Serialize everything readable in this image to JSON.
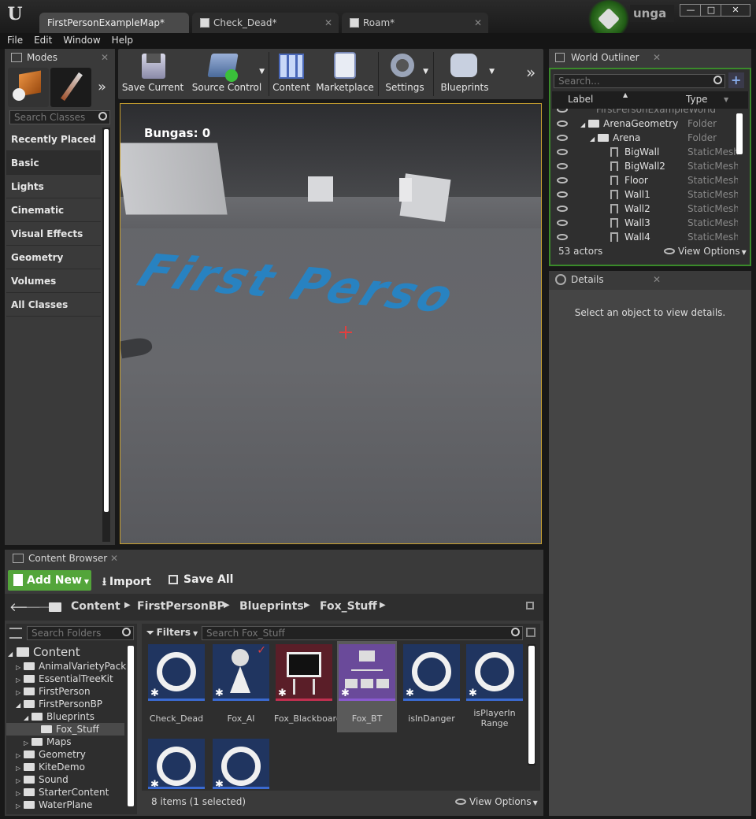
{
  "window": {
    "tabs": [
      {
        "label": "FirstPersonExampleMap*"
      },
      {
        "label": "Check_Dead*"
      },
      {
        "label": "Roam*"
      }
    ],
    "user": "unga",
    "controls": [
      "—",
      "□",
      "✕"
    ]
  },
  "menu": [
    "File",
    "Edit",
    "Window",
    "Help"
  ],
  "modes": {
    "title": "Modes",
    "search_placeholder": "Search Classes",
    "categories": [
      "Recently Placed",
      "Basic",
      "Lights",
      "Cinematic",
      "Visual Effects",
      "Geometry",
      "Volumes",
      "All Classes"
    ],
    "selected": "Basic"
  },
  "toolbar": {
    "buttons": [
      {
        "label": "Save Current"
      },
      {
        "label": "Source Control"
      },
      {
        "label": "Content"
      },
      {
        "label": "Marketplace"
      },
      {
        "label": "Settings"
      },
      {
        "label": "Blueprints"
      }
    ]
  },
  "viewport": {
    "hud": "Bungas: 0",
    "floor_text": "First Perso"
  },
  "outliner": {
    "title": "World Outliner",
    "search_placeholder": "Search...",
    "columns": [
      "Label",
      "Type"
    ],
    "rows": [
      {
        "name": "FirstPersonExampleWorld",
        "type": "",
        "indent": 0
      },
      {
        "name": "ArenaGeometry",
        "type": "Folder",
        "indent": 1
      },
      {
        "name": "Arena",
        "type": "Folder",
        "indent": 2
      },
      {
        "name": "BigWall",
        "type": "StaticMesh.",
        "indent": 3
      },
      {
        "name": "BigWall2",
        "type": "StaticMesh.",
        "indent": 3
      },
      {
        "name": "Floor",
        "type": "StaticMesh.",
        "indent": 3
      },
      {
        "name": "Wall1",
        "type": "StaticMesh.",
        "indent": 3
      },
      {
        "name": "Wall2",
        "type": "StaticMesh.",
        "indent": 3
      },
      {
        "name": "Wall3",
        "type": "StaticMesh.",
        "indent": 3
      },
      {
        "name": "Wall4",
        "type": "StaticMesh.",
        "indent": 3
      }
    ],
    "count": "53 actors",
    "view_options": "View Options"
  },
  "details": {
    "title": "Details",
    "message": "Select an object to view details."
  },
  "content_browser": {
    "title": "Content Browser",
    "add_new": "Add New",
    "import": "Import",
    "save_all": "Save All",
    "breadcrumb": [
      "Content",
      "FirstPersonBP",
      "Blueprints",
      "Fox_Stuff"
    ],
    "folder_search": "Search Folders",
    "filters": "Filters",
    "asset_search": "Search Fox_Stuff",
    "tree": [
      {
        "name": "Content",
        "level": 0,
        "big": true
      },
      {
        "name": "AnimalVarietyPack",
        "level": 1
      },
      {
        "name": "EssentialTreeKit",
        "level": 1
      },
      {
        "name": "FirstPerson",
        "level": 1
      },
      {
        "name": "FirstPersonBP",
        "level": 1
      },
      {
        "name": "Blueprints",
        "level": 2
      },
      {
        "name": "Fox_Stuff",
        "level": 3,
        "selected": true
      },
      {
        "name": "Maps",
        "level": 2
      },
      {
        "name": "Geometry",
        "level": 1
      },
      {
        "name": "KiteDemo",
        "level": 1
      },
      {
        "name": "Sound",
        "level": 1
      },
      {
        "name": "StarterContent",
        "level": 1
      },
      {
        "name": "WaterPlane",
        "level": 1
      }
    ],
    "assets": [
      {
        "name": "Check_Dead",
        "kind": "ring"
      },
      {
        "name": "Fox_AI",
        "kind": "pawn"
      },
      {
        "name": "Fox_Blackboard",
        "kind": "board"
      },
      {
        "name": "Fox_BT",
        "kind": "tree",
        "selected": true
      },
      {
        "name": "isInDanger",
        "kind": "ring"
      },
      {
        "name": "isPlayerIn Range",
        "kind": "ring"
      },
      {
        "name": "",
        "kind": "ring"
      },
      {
        "name": "",
        "kind": "ring"
      }
    ],
    "status": "8 items (1 selected)",
    "view_options": "View Options"
  }
}
